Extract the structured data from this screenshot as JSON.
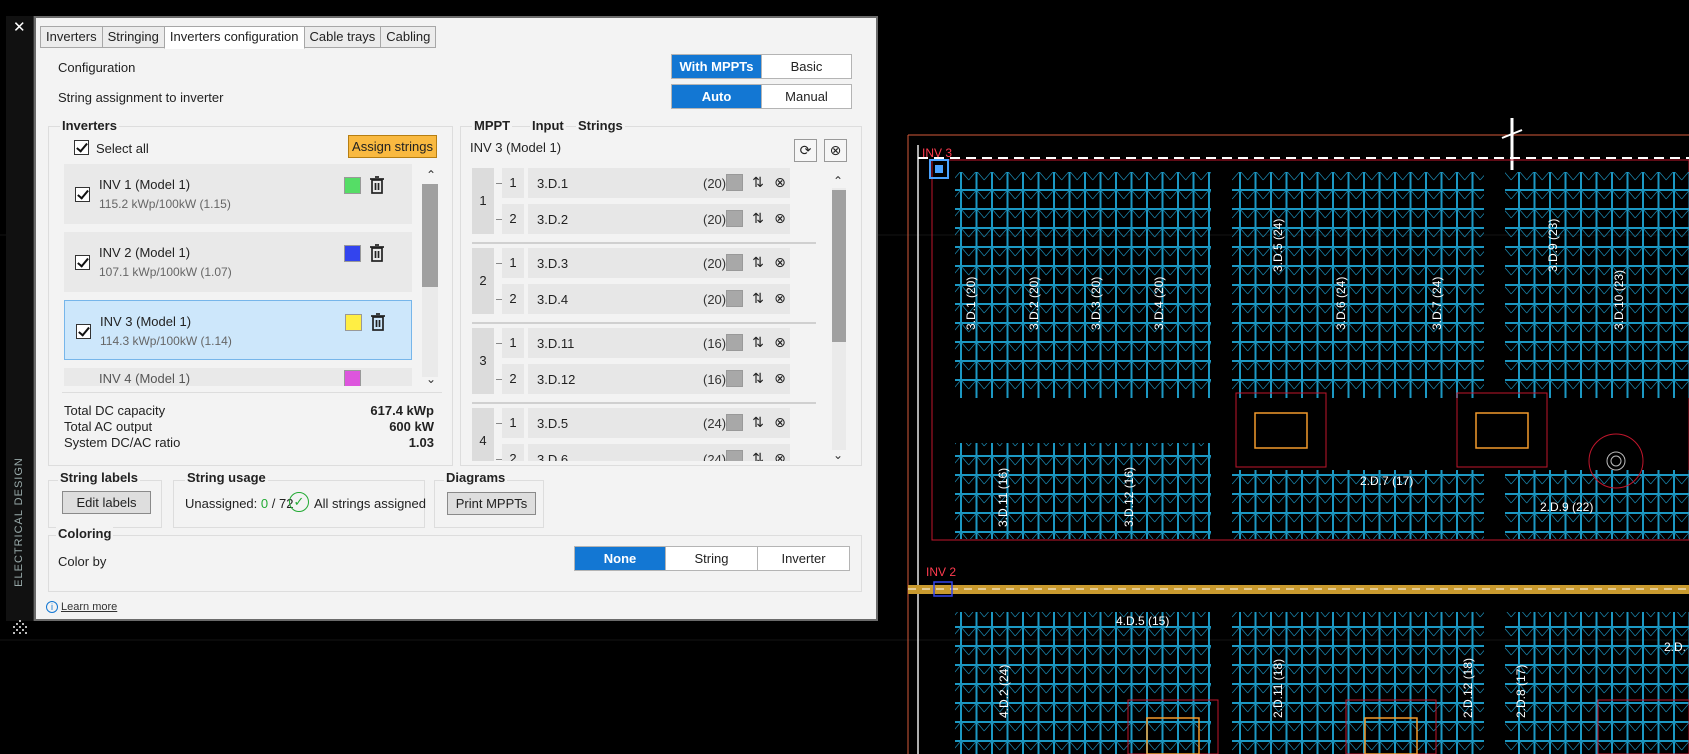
{
  "sidebar": {
    "close_glyph": "✕",
    "vertical_label": "ELECTRICAL DESIGN"
  },
  "tabs": [
    {
      "label": "Inverters"
    },
    {
      "label": "Stringing"
    },
    {
      "label": "Inverters configuration"
    },
    {
      "label": "Cable trays"
    },
    {
      "label": "Cabling"
    }
  ],
  "config": {
    "configuration_label": "Configuration",
    "configuration_options": [
      "With MPPTs",
      "Basic"
    ],
    "assignment_label": "String assignment to inverter",
    "assignment_options": [
      "Auto",
      "Manual"
    ]
  },
  "inverters": {
    "header": "Inverters",
    "select_all": "Select all",
    "assign_button": "Assign strings",
    "items": [
      {
        "name": "INV 1 (Model 1)",
        "detail": "115.2 kWp/100kW (1.15)",
        "color": "#55dd66"
      },
      {
        "name": "INV 2 (Model 1)",
        "detail": "107.1 kWp/100kW (1.07)",
        "color": "#3344ee"
      },
      {
        "name": "INV 3 (Model 1)",
        "detail": "114.3 kWp/100kW (1.14)",
        "color": "#ffee44"
      },
      {
        "name": "INV 4 (Model 1)",
        "color": "#dd55dd"
      }
    ],
    "totals": [
      {
        "label": "Total DC capacity",
        "value": "617.4 kWp"
      },
      {
        "label": "Total AC output",
        "value": "600 kW"
      },
      {
        "label": "System DC/AC ratio",
        "value": "1.03"
      }
    ]
  },
  "mppt": {
    "headers": [
      "MPPT",
      "Input",
      "Strings"
    ],
    "title": "INV 3 (Model 1)",
    "groups": [
      {
        "mppt": "1",
        "rows": [
          {
            "input": "1",
            "string": "3.D.1",
            "count": "(20)"
          },
          {
            "input": "2",
            "string": "3.D.2",
            "count": "(20)"
          }
        ]
      },
      {
        "mppt": "2",
        "rows": [
          {
            "input": "1",
            "string": "3.D.3",
            "count": "(20)"
          },
          {
            "input": "2",
            "string": "3.D.4",
            "count": "(20)"
          }
        ]
      },
      {
        "mppt": "3",
        "rows": [
          {
            "input": "1",
            "string": "3.D.11",
            "count": "(16)"
          },
          {
            "input": "2",
            "string": "3.D.12",
            "count": "(16)"
          }
        ]
      },
      {
        "mppt": "4",
        "rows": [
          {
            "input": "1",
            "string": "3.D.5",
            "count": "(24)"
          },
          {
            "input": "2",
            "string": "3.D.6",
            "count": "(24)"
          }
        ]
      }
    ]
  },
  "string_labels": {
    "header": "String labels",
    "button": "Edit labels"
  },
  "string_usage": {
    "header": "String usage",
    "unassigned_label": "Unassigned:",
    "assigned_count": "0",
    "total": "/ 72",
    "status": "All strings assigned",
    "status_color": "#22aa33"
  },
  "diagrams": {
    "header": "Diagrams",
    "button": "Print MPPTs"
  },
  "coloring": {
    "header": "Coloring",
    "color_by_label": "Color by",
    "options": [
      "None",
      "String",
      "Inverter"
    ]
  },
  "learn_more": "Learn more",
  "cad": {
    "inv_labels": [
      "INV 3",
      "INV 2"
    ],
    "string_labels": [
      "3.D.1 (20)",
      "3.D.2 (20)",
      "3.D.3 (20)",
      "3.D.4 (20)",
      "3.D.5 (24)",
      "3.D.6 (24)",
      "3.D.7 (24)",
      "3.D.9 (23)",
      "3.D.10 (23)",
      "3.D.11 (16)",
      "3.D.12 (16)",
      "2.D.7 (17)",
      "2.D.9 (22)",
      "4.D.5 (15)",
      "4.D.2 (24)",
      "2.D.11 (18)",
      "2.D.12 (18)",
      "2.D.8 (17)",
      "2.D."
    ]
  }
}
